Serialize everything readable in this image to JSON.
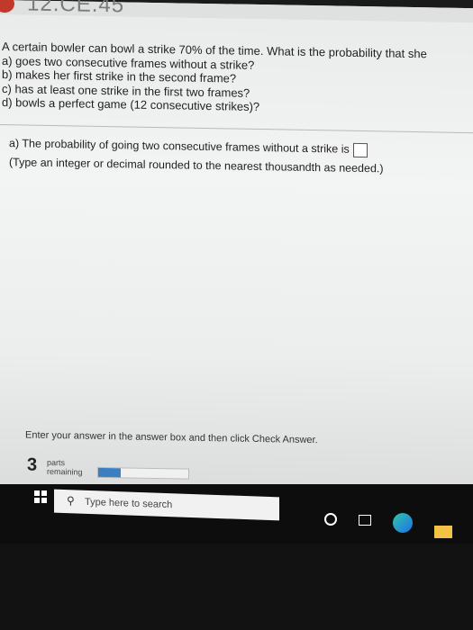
{
  "title": "12.CE.45",
  "question": {
    "intro": "A certain bowler can bowl a strike 70% of the time. What is the probability that she",
    "parts": [
      "a) goes two consecutive frames without a strike?",
      "b) makes her first strike in the second frame?",
      "c) has at least one strike in the first two frames?",
      "d) bowls a perfect game (12 consecutive strikes)?"
    ]
  },
  "answer": {
    "prompt": "a) The probability of going two consecutive frames without a strike is",
    "hint": "(Type an integer or decimal rounded to the nearest thousandth as needed.)",
    "value": ""
  },
  "footer": {
    "instruction": "Enter your answer in the answer box and then click Check Answer.",
    "parts_count": "3",
    "parts_label_line1": "parts",
    "parts_label_line2": "remaining",
    "progress_fraction": 0.25
  },
  "taskbar": {
    "search_placeholder": "Type here to search",
    "icons": [
      "windows-icon",
      "search-icon",
      "cortana-icon",
      "task-view-icon",
      "edge-icon",
      "file-explorer-icon"
    ]
  }
}
